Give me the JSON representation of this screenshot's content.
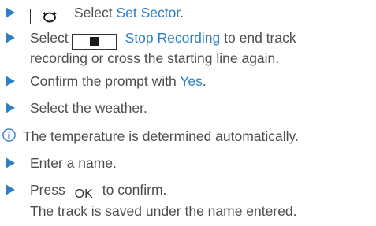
{
  "colors": {
    "accent": "#2f7fc4",
    "text": "#4d4d4d"
  },
  "steps": {
    "set_sector": {
      "icon": "rotate-circle-icon",
      "prefix": "Select ",
      "link": "Set Sector",
      "suffix": "."
    },
    "stop_recording": {
      "prefix": "Select",
      "icon": "stop-square-icon",
      "link": "Stop Recording",
      "line1_rest": " to end track",
      "line2": "recording or cross the starting line again."
    },
    "confirm_prompt": {
      "prefix": "Confirm the prompt with ",
      "link": "Yes",
      "suffix": "."
    },
    "weather": {
      "text": "Select the weather."
    },
    "info_note": {
      "icon": "info-icon",
      "text": "The temperature is determined automatically."
    },
    "enter_name": {
      "text": "Enter a name."
    },
    "press_ok": {
      "prefix": "Press",
      "key": "OK",
      "suffix": "to confirm.",
      "result": "The track is saved under the name entered."
    }
  }
}
